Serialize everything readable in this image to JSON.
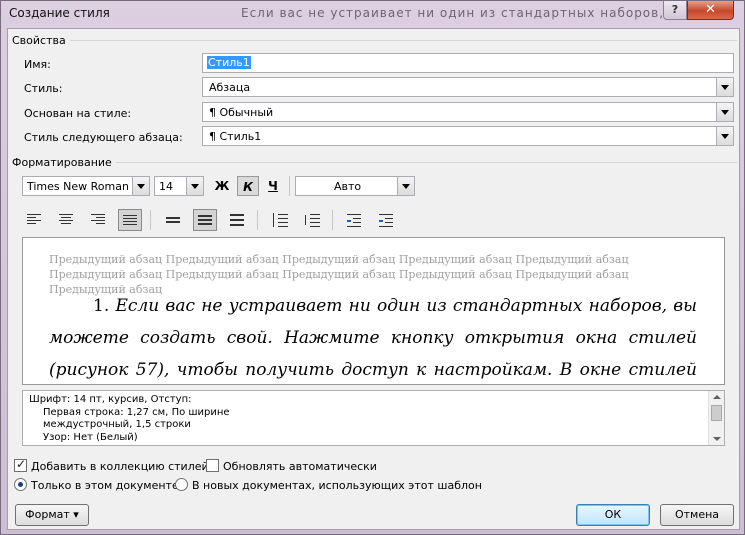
{
  "window": {
    "title": "Создание стиля",
    "background_text": "Если вас не устраивает ни один из стандартных наборов, вы",
    "help_label": "?",
    "close_label": "✕"
  },
  "properties": {
    "group_label": "Свойства",
    "name_label": "Имя:",
    "name_value": "Стиль1",
    "style_type_label": "Стиль:",
    "style_type_value": "Абзаца",
    "based_on_label": "Основан на стиле:",
    "based_on_value": "¶  Обычный",
    "next_para_label": "Стиль следующего абзаца:",
    "next_para_value": "¶  Стиль1"
  },
  "formatting": {
    "group_label": "Форматирование",
    "font_name": "Times New Roman",
    "font_size": "14",
    "bold_label": "Ж",
    "italic_label": "К",
    "underline_label": "Ч",
    "color_value": "Авто"
  },
  "preview": {
    "prev_paragraph": "Предыдущий абзац Предыдущий абзац Предыдущий абзац Предыдущий абзац Предыдущий абзац Предыдущий абзац Предыдущий абзац Предыдущий абзац Предыдущий абзац Предыдущий абзац Предыдущий абзац",
    "number": "1.",
    "sample_text": "Если вас не устраивает ни один из стандартных наборов, вы можете создать свой. Нажмите кнопку открытия окна стилей (рисунок 57), чтобы получить доступ к настройкам. В окне стилей вы можете"
  },
  "description": {
    "line1": "Шрифт: 14 пт, курсив, Отступ:",
    "line2": "Первая строка:  1,27 см, По ширине",
    "line3": "междустрочный,  1,5 строки",
    "line4": "Узор: Нет (Белый)"
  },
  "options": {
    "add_to_gallery": "Добавить в коллекцию стилей",
    "auto_update": "Обновлять автоматически",
    "only_this_doc": "Только в этом документе",
    "new_docs": "В новых документах, использующих этот шаблон"
  },
  "buttons": {
    "format": "Формат ▾",
    "ok": "ОК",
    "cancel": "Отмена"
  }
}
